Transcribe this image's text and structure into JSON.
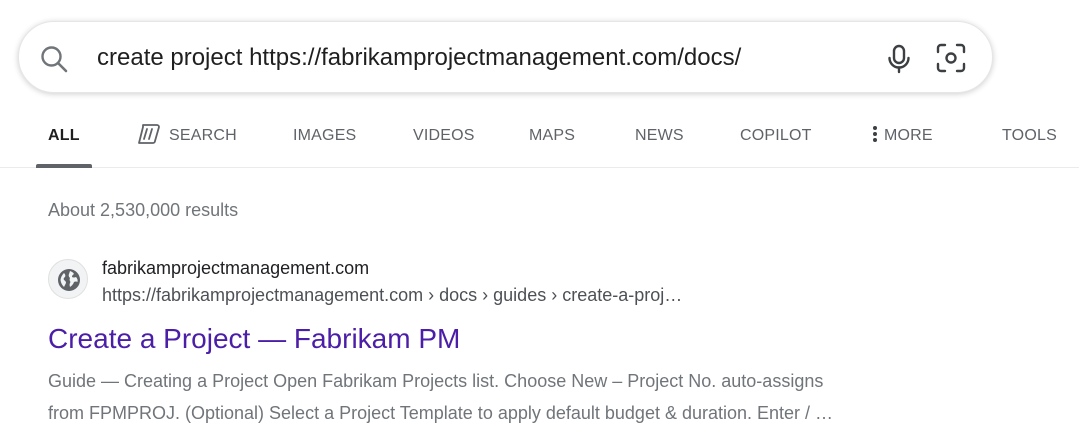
{
  "search": {
    "query": "create project https://fabrikamprojectmanagement.com/docs/"
  },
  "tabs": [
    {
      "label": "ALL",
      "active": true
    },
    {
      "label": "SEARCH",
      "icon": "copilot-search-icon"
    },
    {
      "label": "IMAGES"
    },
    {
      "label": "VIDEOS"
    },
    {
      "label": "MAPS"
    },
    {
      "label": "NEWS"
    },
    {
      "label": "COPILOT"
    },
    {
      "label": "MORE",
      "icon": "vertical-dots-icon"
    },
    {
      "label": "TOOLS"
    }
  ],
  "results_count": "About 2,530,000 results",
  "result": {
    "favicon": "globe-icon",
    "site_name": "fabrikamprojectmanagement.com",
    "url": "https://fabrikamprojectmanagement.com › docs › guides › create-a-proj…",
    "title": "Create a Project — Fabrikam PM",
    "snippet_line1": "Guide — Creating a Project Open Fabrikam Projects list. Choose New – Project No. auto-assigns",
    "snippet_line2": "from FPMPROJ. (Optional) Select a Project Template to apply default budget & duration. Enter / …"
  },
  "colors": {
    "title_link": "#4b1ea8",
    "muted_text": "#70757a",
    "active_tab_underline": "#5f6368"
  }
}
